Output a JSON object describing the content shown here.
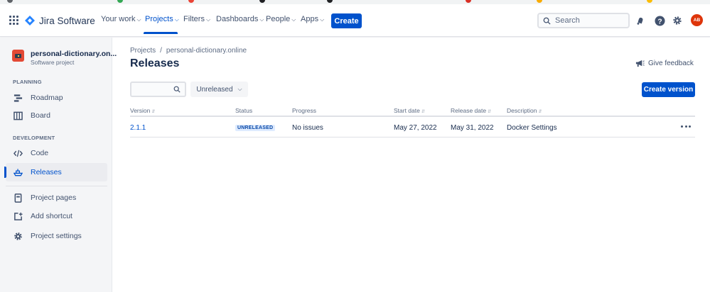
{
  "nav": {
    "product": "Jira Software",
    "items": [
      {
        "label": "Your work"
      },
      {
        "label": "Projects"
      },
      {
        "label": "Filters"
      },
      {
        "label": "Dashboards"
      },
      {
        "label": "People"
      },
      {
        "label": "Apps"
      }
    ],
    "create_label": "Create",
    "search_placeholder": "Search",
    "avatar_initials": "AB"
  },
  "sidebar": {
    "project_name": "personal-dictionary.on...",
    "project_type": "Software project",
    "planning_heading": "PLANNING",
    "development_heading": "DEVELOPMENT",
    "items": [
      {
        "label": "Roadmap",
        "icon": "roadmap-icon"
      },
      {
        "label": "Board",
        "icon": "board-icon"
      },
      {
        "label": "Code",
        "icon": "code-icon"
      },
      {
        "label": "Releases",
        "icon": "releases-icon"
      },
      {
        "label": "Project pages",
        "icon": "page-icon"
      },
      {
        "label": "Add shortcut",
        "icon": "add-shortcut-icon"
      },
      {
        "label": "Project settings",
        "icon": "gear-icon"
      }
    ]
  },
  "breadcrumb": {
    "root": "Projects",
    "separator": "/",
    "current": "personal-dictionary.online"
  },
  "page": {
    "title": "Releases",
    "feedback_label": "Give feedback",
    "status_filter": "Unreleased",
    "create_version_label": "Create version"
  },
  "table": {
    "columns": [
      "Version",
      "Status",
      "Progress",
      "Start date",
      "Release date",
      "Description"
    ],
    "rows": [
      {
        "version": "2.1.1",
        "status": "UNRELEASED",
        "progress": "No issues",
        "start_date": "May 27, 2022",
        "release_date": "May 31, 2022",
        "description": "Docker Settings"
      }
    ]
  },
  "colors": {
    "accent": "#0052cc",
    "sidebar_bg": "#f4f5f7",
    "avatar": "#de350b",
    "project_avatar": "#e34935"
  }
}
